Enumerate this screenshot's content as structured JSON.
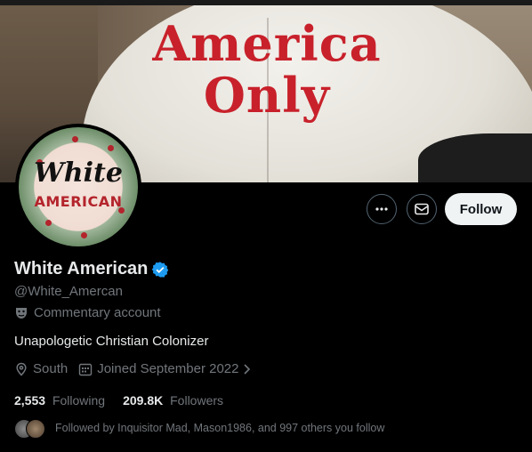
{
  "banner": {
    "cap_line1": "America",
    "cap_line2": "Only"
  },
  "avatar": {
    "line1": "White",
    "line2": "AMERICAN"
  },
  "actions": {
    "more_icon": "more-horizontal-icon",
    "message_icon": "envelope-icon",
    "follow_label": "Follow"
  },
  "profile": {
    "name": "White American",
    "verified_icon": "verified-badge-icon",
    "handle": "@White_Amercan",
    "category": "Commentary account",
    "bio": "Unapologetic Christian Colonizer",
    "location": "South",
    "joined": "Joined September 2022"
  },
  "stats": {
    "following_count": "2,553",
    "following_label": "Following",
    "followers_count": "209.8K",
    "followers_label": "Followers"
  },
  "followed_by": "Followed by Inquisitor Mad, Mason1986, and 997 others you follow",
  "colors": {
    "background": "#000000",
    "text_primary": "#e7e9ea",
    "text_secondary": "#71767b",
    "verified_blue": "#1d9bf0",
    "follow_button_bg": "#eff3f4",
    "cap_text_red": "#c8212b"
  }
}
